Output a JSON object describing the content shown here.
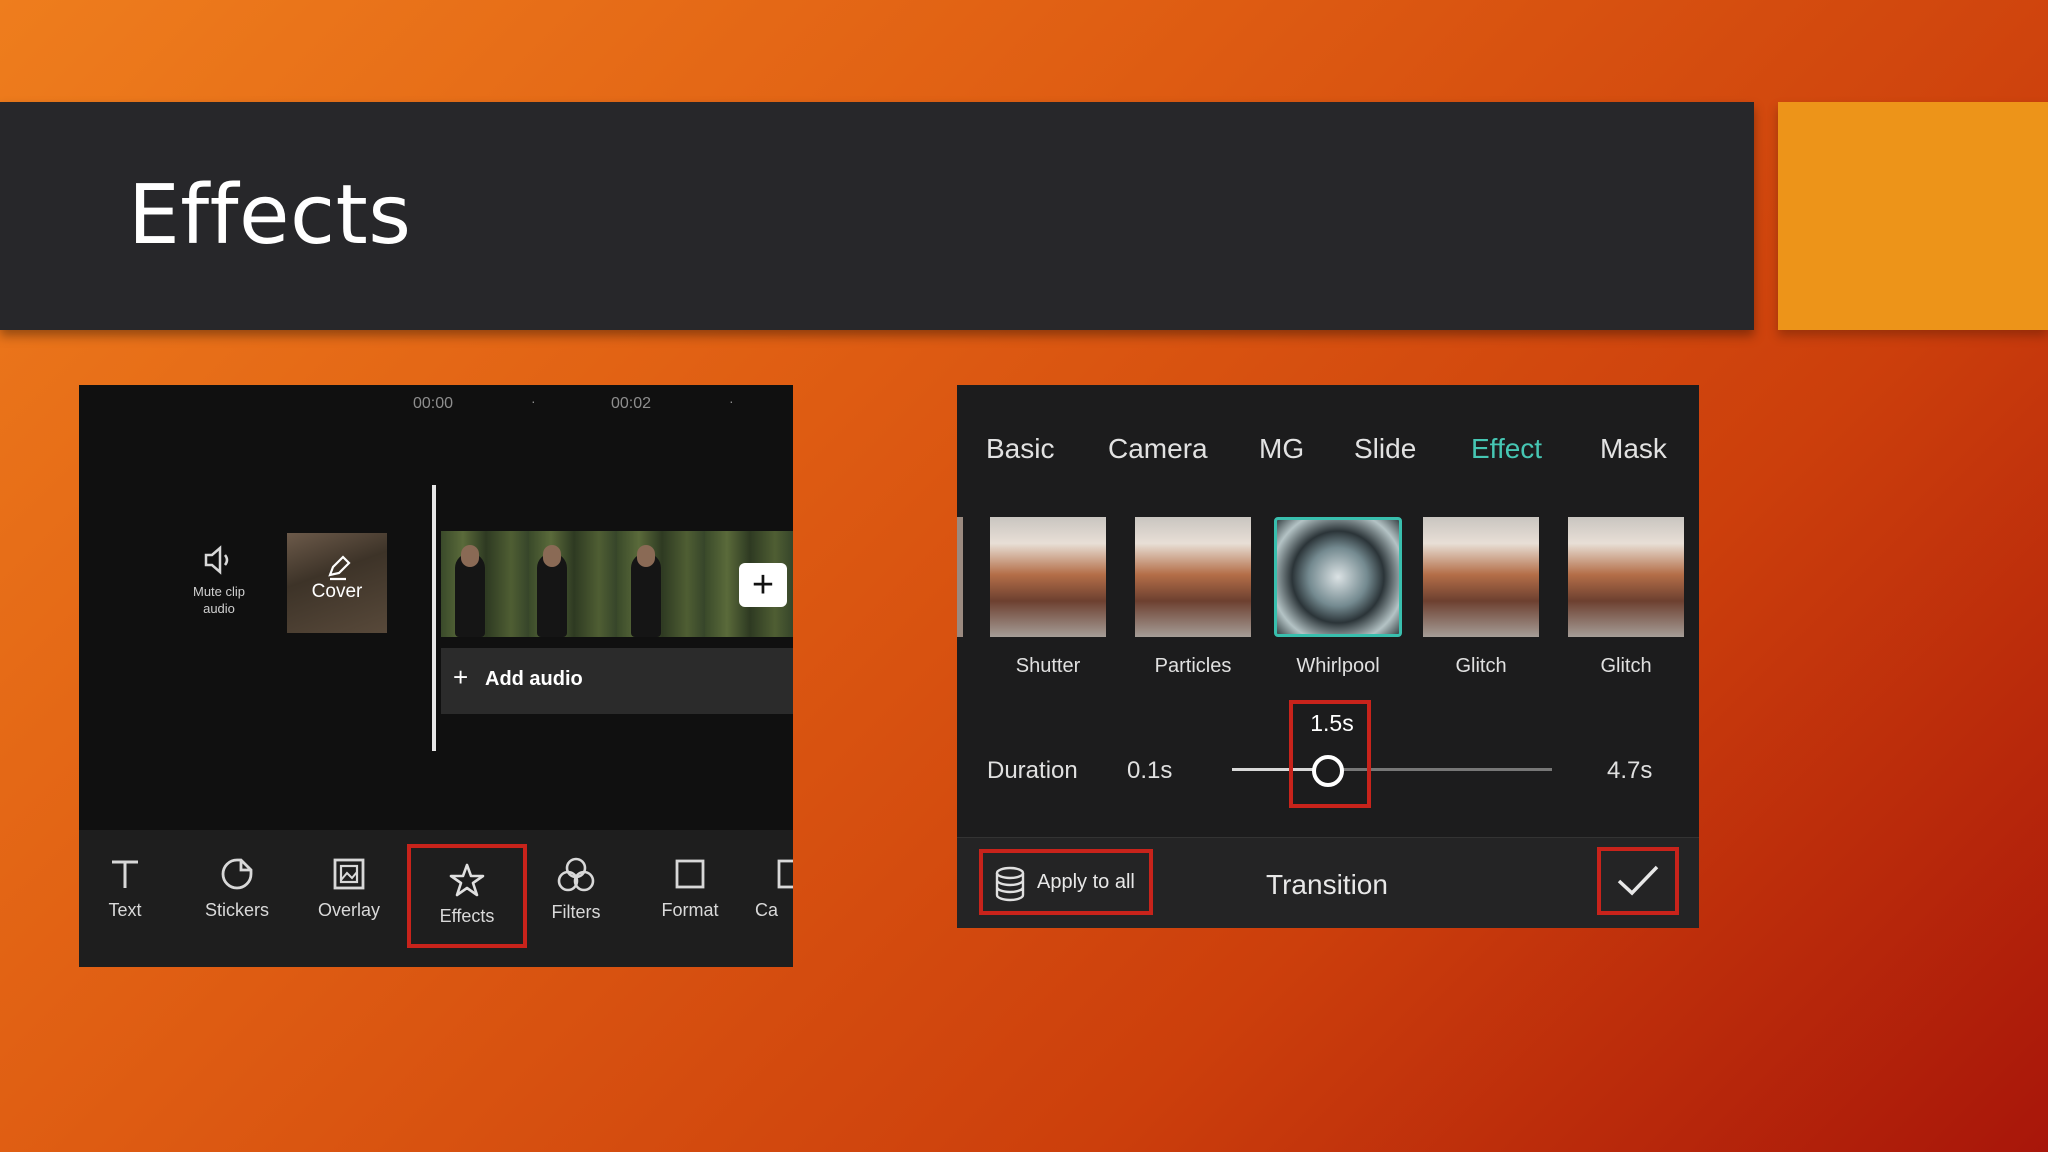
{
  "slide": {
    "title": "Effects",
    "colors": {
      "title_bar": "#27272a",
      "accent": "#ed9419",
      "highlight": "#c8231b",
      "active_tab": "#46c6b3"
    }
  },
  "editor": {
    "timeline": {
      "ticks": [
        "00:00",
        "00:02"
      ],
      "dot": "·"
    },
    "mute_label": "Mute clip audio",
    "cover_label": "Cover",
    "add_clip_symbol": "+",
    "add_audio_label": "Add audio",
    "tools": [
      {
        "label": "Text",
        "icon": "text-icon"
      },
      {
        "label": "Stickers",
        "icon": "sticker-icon"
      },
      {
        "label": "Overlay",
        "icon": "overlay-icon"
      },
      {
        "label": "Effects",
        "icon": "effects-star-icon",
        "selected": true
      },
      {
        "label": "Filters",
        "icon": "filters-icon"
      },
      {
        "label": "Format",
        "icon": "format-icon"
      },
      {
        "label": "Ca",
        "icon": "canvas-icon"
      }
    ]
  },
  "transition_panel": {
    "tabs": [
      "Basic",
      "Camera",
      "MG",
      "Slide",
      "Effect",
      "Mask"
    ],
    "active_tab": "Effect",
    "effects": [
      "Shutter",
      "Particles",
      "Whirlpool",
      "Glitch",
      "Glitch"
    ],
    "selected_effect": "Whirlpool",
    "duration": {
      "label": "Duration",
      "min": "0.1s",
      "max": "4.7s",
      "value": "1.5s",
      "fraction": 0.3
    },
    "apply_all_label": "Apply to all",
    "title": "Transition",
    "confirm_icon": "check-icon"
  }
}
